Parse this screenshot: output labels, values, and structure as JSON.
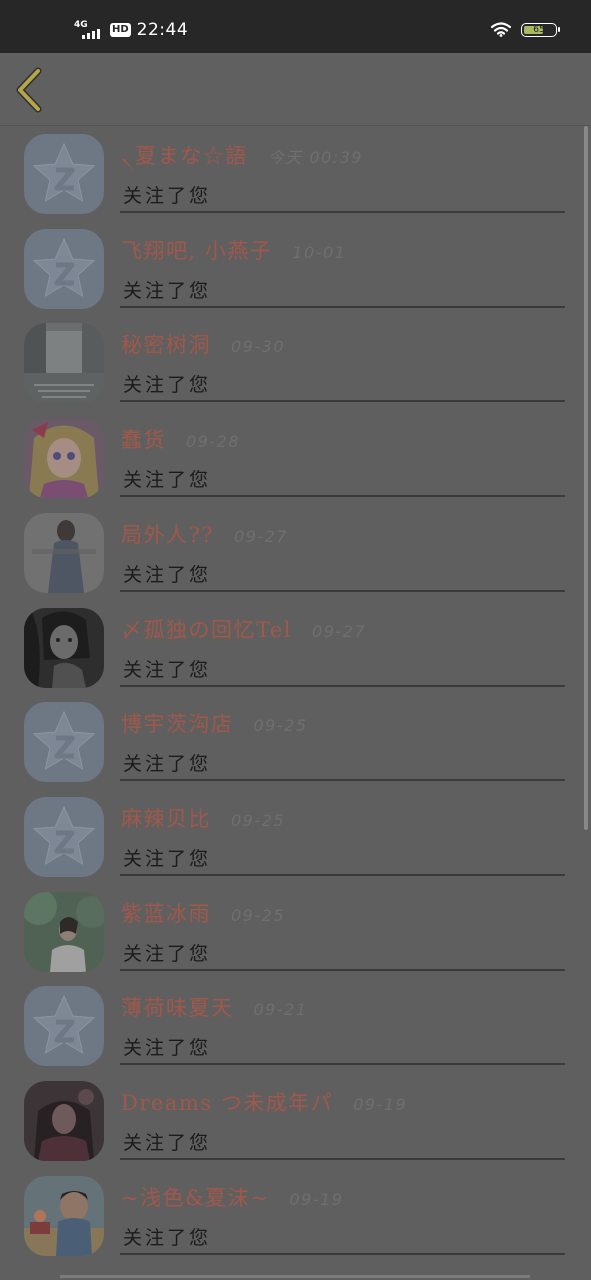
{
  "status_bar": {
    "network": "4G",
    "hd": "HD",
    "time": "22:44",
    "battery": "65",
    "battery_level": 0.65
  },
  "header": {
    "back_icon": "chevron-left-icon",
    "accent_color": "#b6a548"
  },
  "colors": {
    "name": "#a1584a",
    "time": "#6f6f6f",
    "action": "#1b1b1b",
    "background": "#5f5f5f"
  },
  "notifications": [
    {
      "name": "৲夏まな☆語",
      "time": "今天 00:39",
      "action": "关注了您",
      "avatar": "default-qq"
    },
    {
      "name": "飞翔吧, 小燕子",
      "time": "10-01",
      "action": "关注了您",
      "avatar": "default-qq"
    },
    {
      "name": "秘密树洞",
      "time": "09-30",
      "action": "关注了您",
      "avatar": "street-photo"
    },
    {
      "name": "蠢货",
      "time": "09-28",
      "action": "关注了您",
      "avatar": "anime-girl"
    },
    {
      "name": "局外人??",
      "time": "09-27",
      "action": "关注了您",
      "avatar": "girl-photo"
    },
    {
      "name": "〆孤独の回忆Tel",
      "time": "09-27",
      "action": "关注了您",
      "avatar": "bw-girl"
    },
    {
      "name": "博宇茨沟店",
      "time": "09-25",
      "action": "关注了您",
      "avatar": "default-qq"
    },
    {
      "name": "麻辣贝比",
      "time": "09-25",
      "action": "关注了您",
      "avatar": "default-qq"
    },
    {
      "name": "紫蓝冰雨",
      "time": "09-25",
      "action": "关注了您",
      "avatar": "nature-girl"
    },
    {
      "name": "薄荷味夏天",
      "time": "09-21",
      "action": "关注了您",
      "avatar": "default-qq"
    },
    {
      "name": "Dreams つ未成年パ",
      "time": "09-19",
      "action": "关注了您",
      "avatar": "dark-girl"
    },
    {
      "name": "~浅色&夏沫~",
      "time": "09-19",
      "action": "关注了您",
      "avatar": "child-photo"
    }
  ]
}
